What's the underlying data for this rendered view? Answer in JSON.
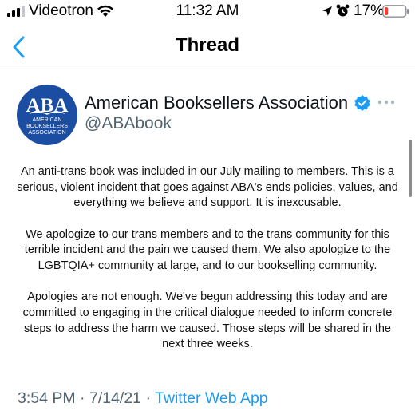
{
  "status_bar": {
    "carrier": "Videotron",
    "time": "11:32 AM",
    "battery_percent": "17%",
    "battery_level": 0.17,
    "battery_color": "#ff3b30"
  },
  "nav": {
    "title": "Thread",
    "back_icon": "chevron-left-icon",
    "accent_color": "#1d9bf0"
  },
  "tweet": {
    "display_name": "American Booksellers Association",
    "handle": "@ABAbook",
    "avatar": {
      "logo_text": "ABA",
      "line1": "AMERICAN",
      "line2": "BOOKSELLERS",
      "line3": "ASSOCIATION",
      "color": "#1b4ea3"
    },
    "verified": true,
    "paragraphs": [
      "An anti-trans book was included in our July mailing to members. This is a serious, violent incident that goes against ABA's ends policies, values, and everything we believe and support. It is inexcusable.",
      "We apologize to our trans members and to the trans community for this terrible incident and the pain we caused them. We also apologize to the LGBTQIA+ community at large, and to our bookselling community.",
      "Apologies are not enough. We've begun addressing this today and are committed to engaging in the critical dialogue needed to inform concrete steps to address the harm we caused. Those steps will be shared in the next three weeks."
    ],
    "time": "3:54 PM",
    "date": "7/14/21",
    "separator": "·",
    "source": "Twitter Web App"
  }
}
